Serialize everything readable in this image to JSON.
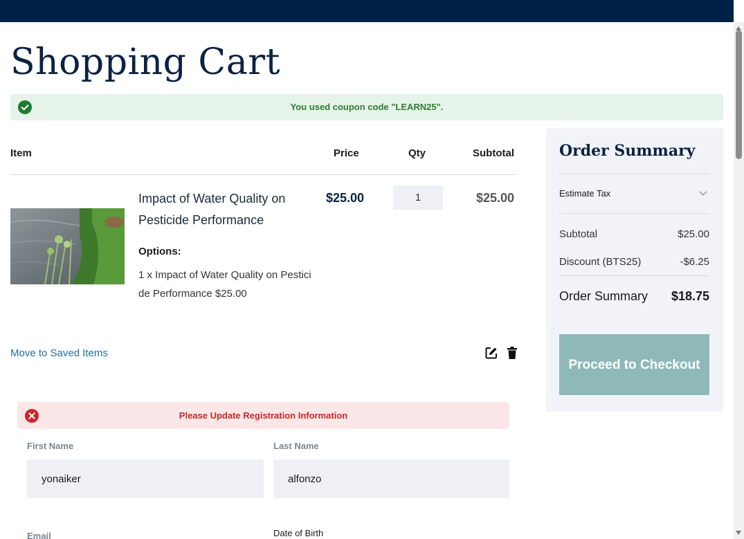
{
  "page": {
    "title": "Shopping Cart"
  },
  "coupon": {
    "message": "You used coupon code \"LEARN25\"."
  },
  "table": {
    "headers": {
      "item": "Item",
      "price": "Price",
      "qty": "Qty",
      "subtotal": "Subtotal"
    }
  },
  "cart_item": {
    "name": "Impact of Water Quality on Pesticide Performance",
    "options_label": "Options:",
    "options_value": "1 x Impact of Water Quality on Pesticide Performance $25.00",
    "price": "$25.00",
    "qty": "1",
    "subtotal": "$25.00",
    "move_link": "Move to Saved Items"
  },
  "summary": {
    "title": "Order Summary",
    "estimate_tax": "Estimate Tax",
    "subtotal_label": "Subtotal",
    "subtotal_value": "$25.00",
    "discount_label": "Discount (BTS25)",
    "discount_value": "-$6.25",
    "total_label": "Order Summary",
    "total_value": "$18.75",
    "checkout_button": "Proceed to Checkout"
  },
  "registration": {
    "alert": "Please Update Registration Information",
    "first_name_label": "First Name",
    "first_name_value": "yonaiker",
    "last_name_label": "Last Name",
    "last_name_value": "alfonzo",
    "email_label": "Email",
    "dob_label": "Date of Birth"
  },
  "colors": {
    "header_bar": "#002147",
    "title": "#0b2240",
    "success": "#2e7d32",
    "error": "#c62828",
    "link": "#1f6f9f",
    "checkout_button": "#8fb8b9"
  },
  "icons": {
    "coupon": "check-circle-icon",
    "alert": "x-circle-icon",
    "edit": "edit-icon",
    "delete": "trash-icon",
    "estimate_tax": "chevron-down-icon"
  }
}
